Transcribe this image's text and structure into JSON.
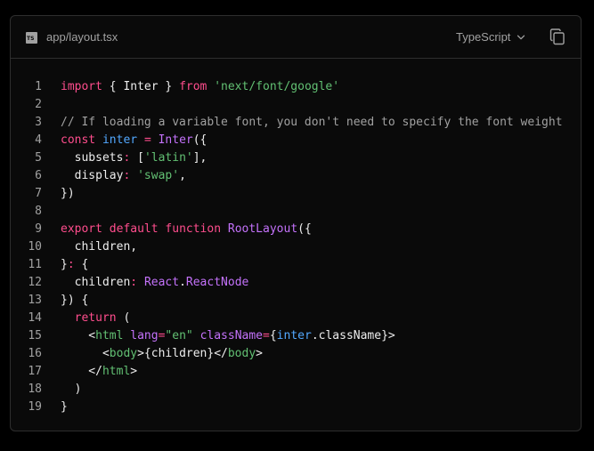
{
  "header": {
    "file_icon_text": "TS",
    "file_name": "app/layout.tsx",
    "language": "TypeScript",
    "copy_icon": "copy-icon"
  },
  "colors": {
    "background": "#0a0a0a",
    "border": "#2e2e2e",
    "text": "#ededed",
    "muted": "#a1a1a1",
    "keyword": "#ff4d8d",
    "string": "#62c073",
    "function": "#c472fb",
    "variable": "#52a8ff"
  },
  "code": {
    "lines": [
      {
        "n": "1",
        "tokens": [
          [
            "kw",
            "import"
          ],
          [
            "plain",
            " { Inter } "
          ],
          [
            "kw",
            "from"
          ],
          [
            "plain",
            " "
          ],
          [
            "str",
            "'next/font/google'"
          ]
        ]
      },
      {
        "n": "2",
        "tokens": []
      },
      {
        "n": "3",
        "tokens": [
          [
            "cm",
            "// If loading a variable font, you don't need to specify the font weight"
          ]
        ]
      },
      {
        "n": "4",
        "tokens": [
          [
            "kw",
            "const"
          ],
          [
            "plain",
            " "
          ],
          [
            "var",
            "inter"
          ],
          [
            "plain",
            " "
          ],
          [
            "kw",
            "="
          ],
          [
            "plain",
            " "
          ],
          [
            "fn",
            "Inter"
          ],
          [
            "plain",
            "({"
          ]
        ]
      },
      {
        "n": "5",
        "tokens": [
          [
            "plain",
            "  subsets"
          ],
          [
            "kw",
            ":"
          ],
          [
            "plain",
            " ["
          ],
          [
            "str",
            "'latin'"
          ],
          [
            "plain",
            "],"
          ]
        ]
      },
      {
        "n": "6",
        "tokens": [
          [
            "plain",
            "  display"
          ],
          [
            "kw",
            ":"
          ],
          [
            "plain",
            " "
          ],
          [
            "str",
            "'swap'"
          ],
          [
            "plain",
            ","
          ]
        ]
      },
      {
        "n": "7",
        "tokens": [
          [
            "plain",
            "})"
          ]
        ]
      },
      {
        "n": "8",
        "tokens": []
      },
      {
        "n": "9",
        "tokens": [
          [
            "kw",
            "export"
          ],
          [
            "plain",
            " "
          ],
          [
            "kw",
            "default"
          ],
          [
            "plain",
            " "
          ],
          [
            "kw",
            "function"
          ],
          [
            "plain",
            " "
          ],
          [
            "fn",
            "RootLayout"
          ],
          [
            "plain",
            "({"
          ]
        ]
      },
      {
        "n": "10",
        "tokens": [
          [
            "plain",
            "  children,"
          ]
        ]
      },
      {
        "n": "11",
        "tokens": [
          [
            "plain",
            "}"
          ],
          [
            "kw",
            ":"
          ],
          [
            "plain",
            " {"
          ]
        ]
      },
      {
        "n": "12",
        "tokens": [
          [
            "plain",
            "  children"
          ],
          [
            "kw",
            ":"
          ],
          [
            "plain",
            " "
          ],
          [
            "fn",
            "React"
          ],
          [
            "plain",
            "."
          ],
          [
            "fn",
            "ReactNode"
          ]
        ]
      },
      {
        "n": "13",
        "tokens": [
          [
            "plain",
            "}) {"
          ]
        ]
      },
      {
        "n": "14",
        "tokens": [
          [
            "plain",
            "  "
          ],
          [
            "kw",
            "return"
          ],
          [
            "plain",
            " ("
          ]
        ]
      },
      {
        "n": "15",
        "tokens": [
          [
            "plain",
            "    <"
          ],
          [
            "tag",
            "html"
          ],
          [
            "plain",
            " "
          ],
          [
            "attr",
            "lang"
          ],
          [
            "kw",
            "="
          ],
          [
            "str",
            "\"en\""
          ],
          [
            "plain",
            " "
          ],
          [
            "attr",
            "className"
          ],
          [
            "kw",
            "="
          ],
          [
            "plain",
            "{"
          ],
          [
            "var",
            "inter"
          ],
          [
            "plain",
            ".className}>"
          ]
        ]
      },
      {
        "n": "16",
        "tokens": [
          [
            "plain",
            "      <"
          ],
          [
            "tag",
            "body"
          ],
          [
            "plain",
            ">{children}</"
          ],
          [
            "tag",
            "body"
          ],
          [
            "plain",
            ">"
          ]
        ]
      },
      {
        "n": "17",
        "tokens": [
          [
            "plain",
            "    </"
          ],
          [
            "tag",
            "html"
          ],
          [
            "plain",
            ">"
          ]
        ]
      },
      {
        "n": "18",
        "tokens": [
          [
            "plain",
            "  )"
          ]
        ]
      },
      {
        "n": "19",
        "tokens": [
          [
            "plain",
            "}"
          ]
        ]
      }
    ]
  }
}
